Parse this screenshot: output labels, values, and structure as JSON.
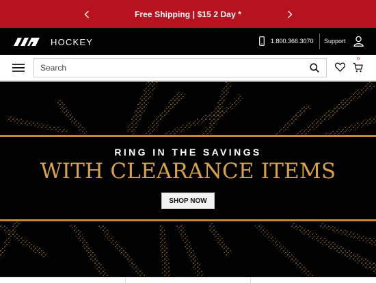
{
  "promo": {
    "text": "Free Shipping | $15 2 Day *",
    "background": "#b7121f"
  },
  "header": {
    "brand": "HOCKEY",
    "phone": "1.800.366.3070",
    "support": "Support"
  },
  "search": {
    "placeholder": "Search",
    "cart_count": "0"
  },
  "hero": {
    "kicker": "RING IN THE SAVINGS",
    "title": "WITH CLEARANCE ITEMS",
    "cta": "SHOP NOW",
    "accent": "#d8a24a"
  },
  "icons": [
    "chevron-left-icon",
    "chevron-right-icon",
    "logo-icon",
    "phone-icon",
    "user-icon",
    "menu-icon",
    "search-icon",
    "heart-icon",
    "cart-icon"
  ]
}
